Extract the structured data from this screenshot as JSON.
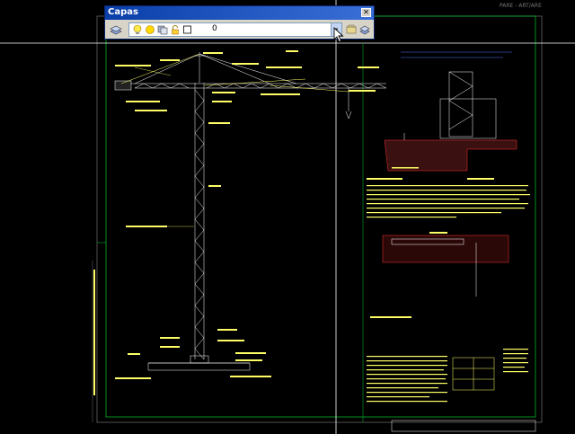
{
  "dialog": {
    "title": "Capas",
    "close_label": "✕",
    "layer_value": "0",
    "combo_arrow": "▾"
  },
  "icons": {
    "layer_manager": "layers-stack-icon",
    "bulb": "light-bulb-icon",
    "sun": "freeze-sun-icon",
    "layers": "layer-states-icon",
    "lock": "lock-icon",
    "color": "color-swatch-icon",
    "make_current": "make-current-layer-icon",
    "previous": "previous-layer-icon"
  },
  "status_text": "PARE - ART/ARE",
  "drawing": {
    "crane_labels": [
      "PIE DE PLUMA",
      "PLUMA",
      "TRAMO DE PLUMA",
      "TIRANTE DE PLUMA",
      "ELEMENTO DE PLUMA",
      "PUNTA DE PLUMA",
      "CONTRAPESO",
      "TORRE",
      "TELESCOPAJE",
      "CARRO",
      "GANCHO",
      "TRAMO DE TORRE",
      "BASE DE TORRE",
      "CABLE DE ELEVACIÓN",
      "MECANISMO DE ELEVACIÓN",
      "MECANISMO DE GIRO",
      "PIE DE TORRE",
      "CONTRAPLUMA",
      "TIRANTE DE CONTRAPLUMA",
      "ANCLAJE",
      "LASTRE DE BASE"
    ],
    "section_titles": [
      "CABLE CONDUCTOR",
      "ELEVACIÓN DE PIEZA",
      "Zanja",
      "Detalle de Placa",
      "TIPO DE ANCLAJE"
    ]
  },
  "colors": {
    "background": "#000000",
    "cad_yellow": "#ffff66",
    "cad_white": "#ffffff",
    "cad_green": "#00cc33",
    "cad_red": "#ff3333",
    "cad_blue": "#5577ff",
    "dialog_title": "#0a3ea8",
    "dialog_body": "#d8d4c8"
  }
}
